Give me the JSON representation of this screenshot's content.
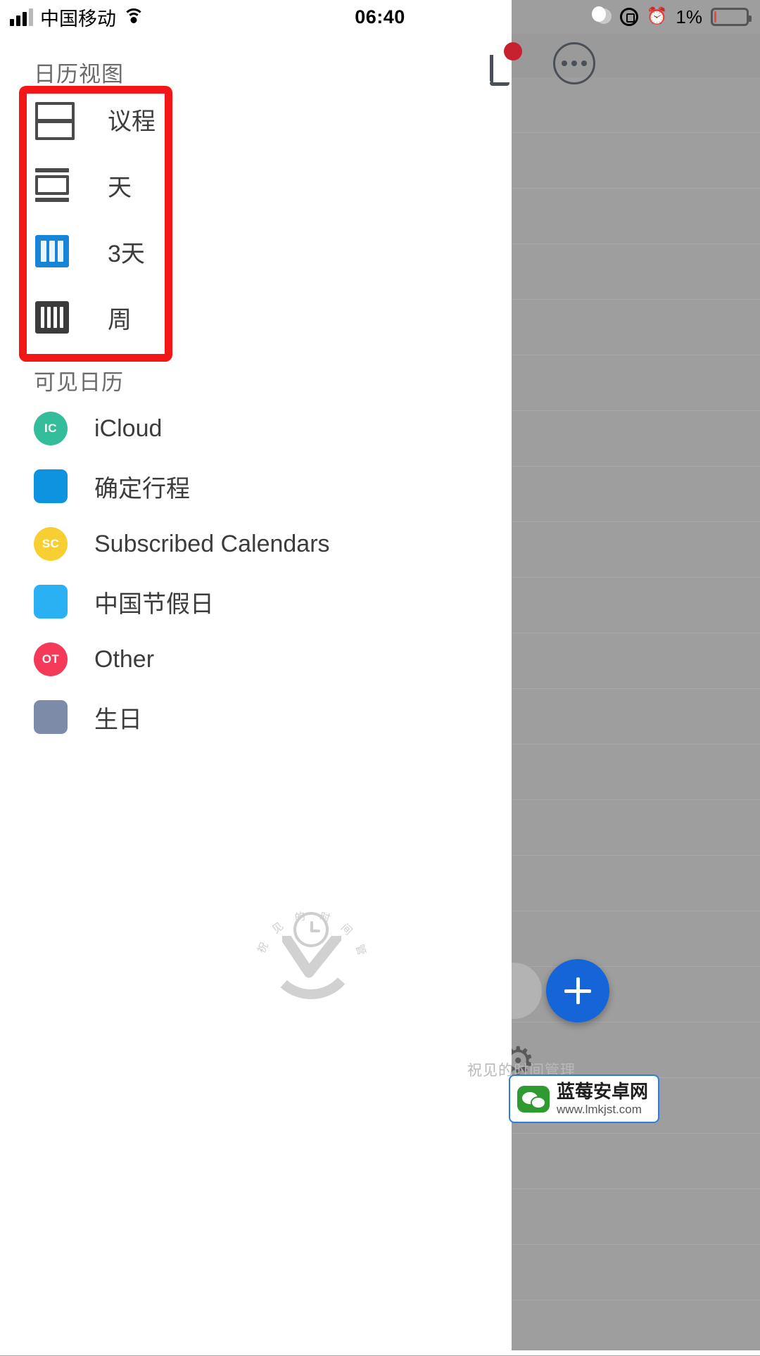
{
  "status_bar": {
    "carrier": "中国移动",
    "time": "06:40",
    "battery_percent": "1%",
    "icons": {
      "signal": "signal-bars-icon",
      "wifi": "wifi-icon",
      "dnd": "moon-icon",
      "rotation_lock": "rotation-lock-icon",
      "alarm": "alarm-clock-icon",
      "battery": "battery-icon"
    }
  },
  "drawer": {
    "calendar_view": {
      "label": "日历视图",
      "items": [
        {
          "label": "议程",
          "icon": "agenda-view-icon",
          "selected": false
        },
        {
          "label": "天",
          "icon": "day-view-icon",
          "selected": false
        },
        {
          "label": "3天",
          "icon": "three-day-view-icon",
          "selected": true
        },
        {
          "label": "周",
          "icon": "week-view-icon",
          "selected": false
        }
      ]
    },
    "visible_calendars": {
      "label": "可见日历",
      "items": [
        {
          "name": "iCloud",
          "initials": "IC",
          "shape": "circle",
          "color": "#33bd9a"
        },
        {
          "name": "确定行程",
          "initials": "",
          "shape": "square",
          "color": "#0d93e0"
        },
        {
          "name": "Subscribed Calendars",
          "initials": "SC",
          "shape": "circle",
          "color": "#f7cf33"
        },
        {
          "name": "中国节假日",
          "initials": "",
          "shape": "square",
          "color": "#29b1f3"
        },
        {
          "name": "Other",
          "initials": "OT",
          "shape": "circle",
          "color": "#f43a58"
        },
        {
          "name": "生日",
          "initials": "",
          "shape": "square",
          "color": "#7d8ba8"
        }
      ]
    }
  },
  "background_app": {
    "more_button": "more-options-button",
    "add_event_button": "+",
    "settings_icon": "gear-icon"
  },
  "watermark": {
    "arc_text": "祝 见 的 时 间 管 理",
    "footer_text": "祝见的时间管理"
  },
  "bottom_banner": {
    "title": "蓝莓安卓网",
    "subtitle": "www.lmkjst.com",
    "icon": "wechat-icon"
  },
  "colors": {
    "highlight_box": "#f21616",
    "selected_view": "#1884d8",
    "fab": "#1565d8",
    "battery_low": "#f1424a"
  }
}
